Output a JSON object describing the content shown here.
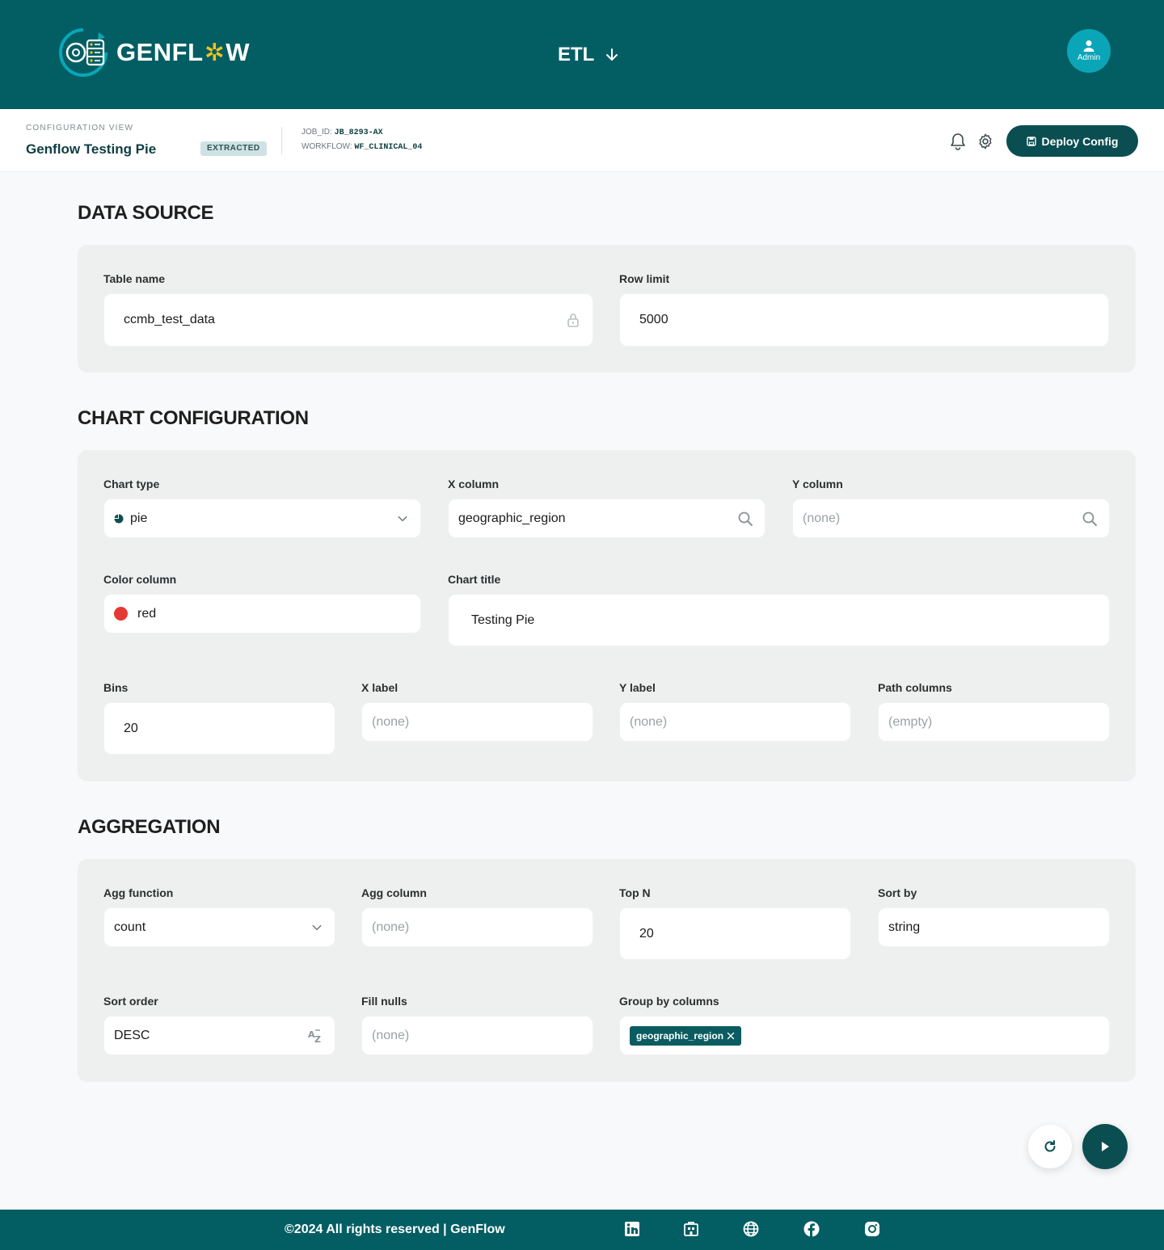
{
  "header": {
    "brand_left": "GENFL",
    "brand_gear": "✲",
    "brand_right": "W",
    "module": "ETL",
    "avatar_label": "Admin"
  },
  "subbar": {
    "kicker": "CONFIGURATION VIEW",
    "title": "Genflow Testing Pie",
    "badge": "EXTRACTED",
    "job_label": "JOB_ID:",
    "job_value": "JB_8293-AX",
    "workflow_label": "WORKFLOW:",
    "workflow_value": "WF_CLINICAL_04",
    "deploy_label": "Deploy Config"
  },
  "data_source": {
    "title": "DATA SOURCE",
    "table_name_label": "Table name",
    "table_name_value": "ccmb_test_data",
    "row_limit_label": "Row limit",
    "row_limit_value": "5000"
  },
  "chart_config": {
    "title": "CHART CONFIGURATION",
    "chart_type_label": "Chart type",
    "chart_type_value": "pie",
    "x_column_label": "X column",
    "x_column_value": "geographic_region",
    "y_column_label": "Y column",
    "y_column_placeholder": "(none)",
    "color_column_label": "Color column",
    "color_column_value": "red",
    "color_swatch": "#e53935",
    "chart_title_label": "Chart title",
    "chart_title_value": "Testing Pie",
    "bins_label": "Bins",
    "bins_value": "20",
    "x_label_label": "X label",
    "x_label_placeholder": "(none)",
    "y_label_label": "Y label",
    "y_label_placeholder": "(none)",
    "path_columns_label": "Path columns",
    "path_columns_placeholder": "(empty)"
  },
  "aggregation": {
    "title": "AGGREGATION",
    "agg_function_label": "Agg function",
    "agg_function_value": "count",
    "agg_column_label": "Agg column",
    "agg_column_placeholder": "(none)",
    "top_n_label": "Top N",
    "top_n_value": "20",
    "sort_by_label": "Sort by",
    "sort_by_value": "string",
    "sort_order_label": "Sort order",
    "sort_order_value": "DESC",
    "fill_nulls_label": "Fill nulls",
    "fill_nulls_placeholder": "(none)",
    "group_by_label": "Group by columns",
    "group_by_chips": [
      "geographic_region"
    ]
  },
  "footer": {
    "copyright": "©2024 All rights reserved | GenFlow",
    "social_icons": [
      "linkedin-icon",
      "building-icon",
      "globe-icon",
      "facebook-icon",
      "instagram-icon"
    ]
  },
  "colors": {
    "brand_teal": "#035e63",
    "button_dark": "#0b4e52",
    "avatar": "#0ba5b8",
    "accent_yellow": "#f4c21b"
  }
}
